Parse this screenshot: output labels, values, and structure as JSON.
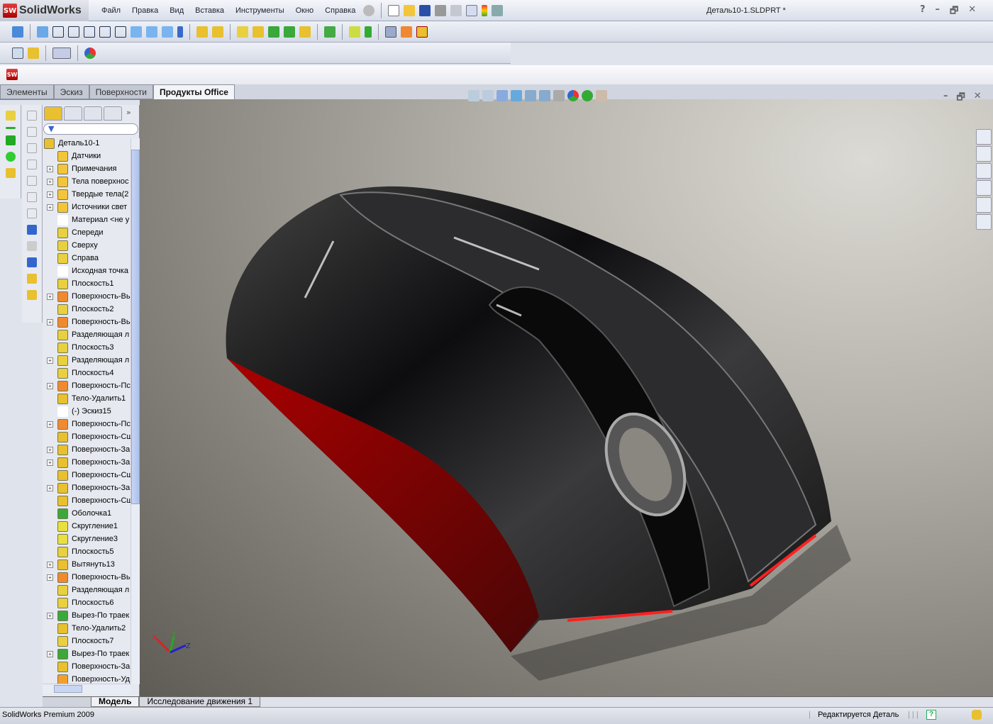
{
  "app": {
    "name": "SolidWorks",
    "logo_badge": "SW",
    "document_title": "Деталь10-1.SLDPRT *"
  },
  "menu": [
    "Файл",
    "Правка",
    "Вид",
    "Вставка",
    "Инструменты",
    "Окно",
    "Справка"
  ],
  "command_tabs": [
    {
      "label": "Элементы"
    },
    {
      "label": "Эскиз"
    },
    {
      "label": "Поверхности"
    },
    {
      "label": "Продукты Office",
      "active": true
    }
  ],
  "tree": {
    "root": "Деталь10-1",
    "items": [
      {
        "label": "Датчики",
        "expandable": false,
        "icon": "sensor-folder-icon"
      },
      {
        "label": "Примечания",
        "expandable": true,
        "icon": "annotations-folder-icon"
      },
      {
        "label": "Тела поверхнос",
        "expandable": true,
        "icon": "surface-bodies-folder-icon"
      },
      {
        "label": "Твердые тела(2",
        "expandable": true,
        "icon": "solid-bodies-folder-icon"
      },
      {
        "label": "Источники свет",
        "expandable": true,
        "icon": "lights-folder-icon"
      },
      {
        "label": "Материал <не у",
        "expandable": false,
        "icon": "material-icon"
      },
      {
        "label": "Спереди",
        "expandable": false,
        "icon": "plane-icon"
      },
      {
        "label": "Сверху",
        "expandable": false,
        "icon": "plane-icon"
      },
      {
        "label": "Справа",
        "expandable": false,
        "icon": "plane-icon"
      },
      {
        "label": "Исходная точка",
        "expandable": false,
        "icon": "origin-icon"
      },
      {
        "label": "Плоскость1",
        "expandable": false,
        "icon": "plane-icon"
      },
      {
        "label": "Поверхность-Вь",
        "expandable": true,
        "icon": "surface-extrude-icon"
      },
      {
        "label": "Плоскость2",
        "expandable": false,
        "icon": "plane-icon"
      },
      {
        "label": "Поверхность-Вь",
        "expandable": true,
        "icon": "surface-extrude-icon"
      },
      {
        "label": "Разделяющая л",
        "expandable": false,
        "icon": "split-line-icon"
      },
      {
        "label": "Плоскость3",
        "expandable": false,
        "icon": "plane-icon"
      },
      {
        "label": "Разделяющая л",
        "expandable": true,
        "icon": "split-line-icon"
      },
      {
        "label": "Плоскость4",
        "expandable": false,
        "icon": "plane-icon"
      },
      {
        "label": "Поверхность-Пс",
        "expandable": true,
        "icon": "surface-loft-icon"
      },
      {
        "label": "Тело-Удалить1",
        "expandable": false,
        "icon": "delete-body-icon"
      },
      {
        "label": "(-) Эскиз15",
        "expandable": false,
        "icon": "sketch-icon"
      },
      {
        "label": "Поверхность-Пс",
        "expandable": true,
        "icon": "surface-loft-icon"
      },
      {
        "label": "Поверхность-Сш",
        "expandable": false,
        "icon": "surface-knit-icon"
      },
      {
        "label": "Поверхность-За",
        "expandable": true,
        "icon": "surface-fill-icon"
      },
      {
        "label": "Поверхность-За",
        "expandable": true,
        "icon": "surface-fill-icon"
      },
      {
        "label": "Поверхность-Сш",
        "expandable": false,
        "icon": "surface-knit-icon"
      },
      {
        "label": "Поверхность-За",
        "expandable": true,
        "icon": "surface-fill-icon"
      },
      {
        "label": "Поверхность-Сш",
        "expandable": false,
        "icon": "surface-knit-icon"
      },
      {
        "label": "Оболочка1",
        "expandable": false,
        "icon": "shell-icon"
      },
      {
        "label": "Скругление1",
        "expandable": false,
        "icon": "fillet-icon"
      },
      {
        "label": "Скругление3",
        "expandable": false,
        "icon": "fillet-icon"
      },
      {
        "label": "Плоскость5",
        "expandable": false,
        "icon": "plane-icon"
      },
      {
        "label": "Вытянуть13",
        "expandable": true,
        "icon": "extrude-icon"
      },
      {
        "label": "Поверхность-Вь",
        "expandable": true,
        "icon": "surface-extrude-icon"
      },
      {
        "label": "Разделяющая л",
        "expandable": false,
        "icon": "split-line-icon"
      },
      {
        "label": "Плоскость6",
        "expandable": false,
        "icon": "plane-icon"
      },
      {
        "label": "Вырез-По траек",
        "expandable": true,
        "icon": "swept-cut-icon"
      },
      {
        "label": "Тело-Удалить2",
        "expandable": false,
        "icon": "delete-body-icon"
      },
      {
        "label": "Плоскость7",
        "expandable": false,
        "icon": "plane-icon"
      },
      {
        "label": "Вырез-По траек",
        "expandable": true,
        "icon": "swept-cut-icon"
      },
      {
        "label": "Поверхность-За",
        "expandable": false,
        "icon": "surface-fill-icon"
      },
      {
        "label": "Поверхность-Уд",
        "expandable": false,
        "icon": "surface-delete-icon"
      }
    ]
  },
  "triad": {
    "x": "X",
    "y": "Y",
    "z": "Z"
  },
  "bottom_tabs": [
    {
      "label": "Модель",
      "active": true
    },
    {
      "label": "Исследование движения 1"
    }
  ],
  "status": {
    "left": "SolidWorks Premium 2009",
    "state": "Редактируется Деталь",
    "help_glyph": "?"
  },
  "window_buttons": {
    "help": "?",
    "minimize": "–",
    "restore": "🗗",
    "close": "✕"
  },
  "colors": {
    "model_body": "#1b1b1d",
    "model_accent": "#8a0a0a",
    "highlight_red": "#ff2020",
    "accent": "#3366cc"
  }
}
